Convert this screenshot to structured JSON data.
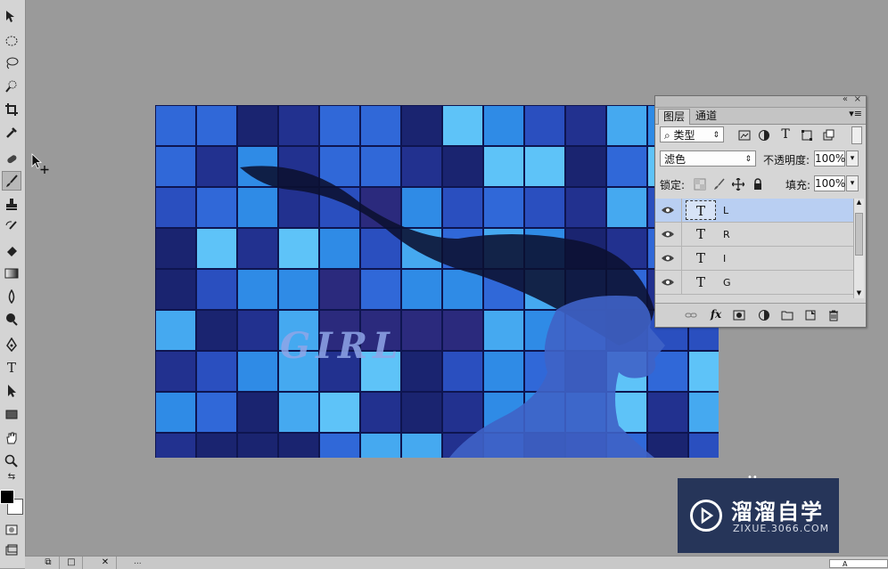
{
  "toolbar": {
    "tools": [
      "move-tool",
      "elliptical-marquee-tool",
      "lasso-tool",
      "quick-selection-tool",
      "crop-tool",
      "eyedropper-tool",
      "spot-healing-brush-tool",
      "brush-tool",
      "clone-stamp-tool",
      "history-brush-tool",
      "eraser-tool",
      "gradient-tool",
      "blur-tool",
      "dodge-tool",
      "pen-tool",
      "type-tool",
      "path-selection-tool",
      "rectangle-tool",
      "hand-tool",
      "zoom-tool"
    ],
    "active_tool": "brush-tool",
    "foreground_color": "#000000",
    "background_color": "#ffffff"
  },
  "canvas": {
    "text_overlay": "GIRL",
    "accent_colors": [
      "#1c2a8a",
      "#2f6fe0",
      "#4fb4f5",
      "#3a2d8f"
    ]
  },
  "layers_panel": {
    "tabs": [
      {
        "label": "图层",
        "active": true
      },
      {
        "label": "通道",
        "active": false
      }
    ],
    "filter_kind_label": "类型",
    "blend_mode": "滤色",
    "opacity_label": "不透明度:",
    "opacity_value": "100%",
    "lock_label": "锁定:",
    "fill_label": "填充:",
    "fill_value": "100%",
    "layers": [
      {
        "name": "L",
        "type": "T",
        "visible": true,
        "selected": true
      },
      {
        "name": "R",
        "type": "T",
        "visible": true,
        "selected": false
      },
      {
        "name": "I",
        "type": "T",
        "visible": true,
        "selected": false
      },
      {
        "name": "G",
        "type": "T",
        "visible": true,
        "selected": false
      }
    ],
    "footer_fx_label": "fx"
  },
  "watermark": {
    "title": "溜溜自学",
    "url": "ZIXUE.3066.COM"
  },
  "status": {
    "doc_tab_label": "...",
    "corner_label": "A"
  }
}
